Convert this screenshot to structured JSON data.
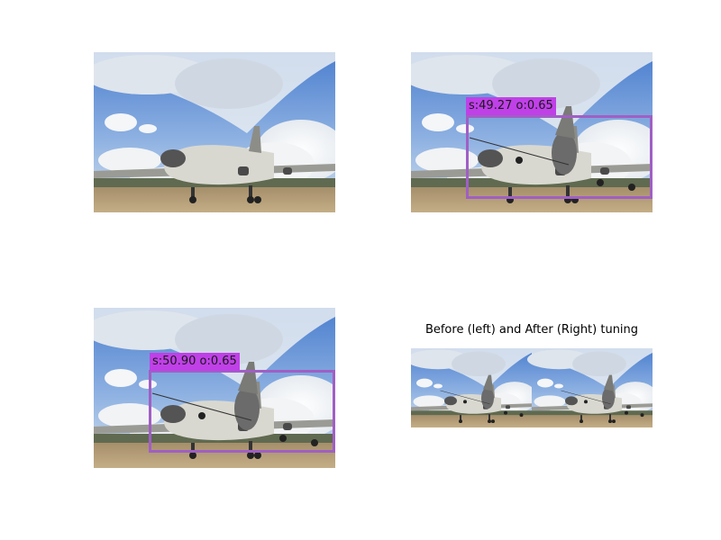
{
  "panels": [
    {
      "id": "original",
      "detection_label": null
    },
    {
      "id": "detection-1",
      "detection_label": "s:49.27 o:0.65"
    },
    {
      "id": "detection-2",
      "detection_label": "s:50.90 o:0.65"
    },
    {
      "id": "comparison"
    }
  ],
  "comparison_title": "Before (left) and After (Right) tuning",
  "colors": {
    "box_stroke": "#a05fc4",
    "label_background": "#c040e8",
    "sky": "#5b8dd6",
    "ground": "#b9a27a"
  },
  "icons": [
    "airplane-photo"
  ]
}
